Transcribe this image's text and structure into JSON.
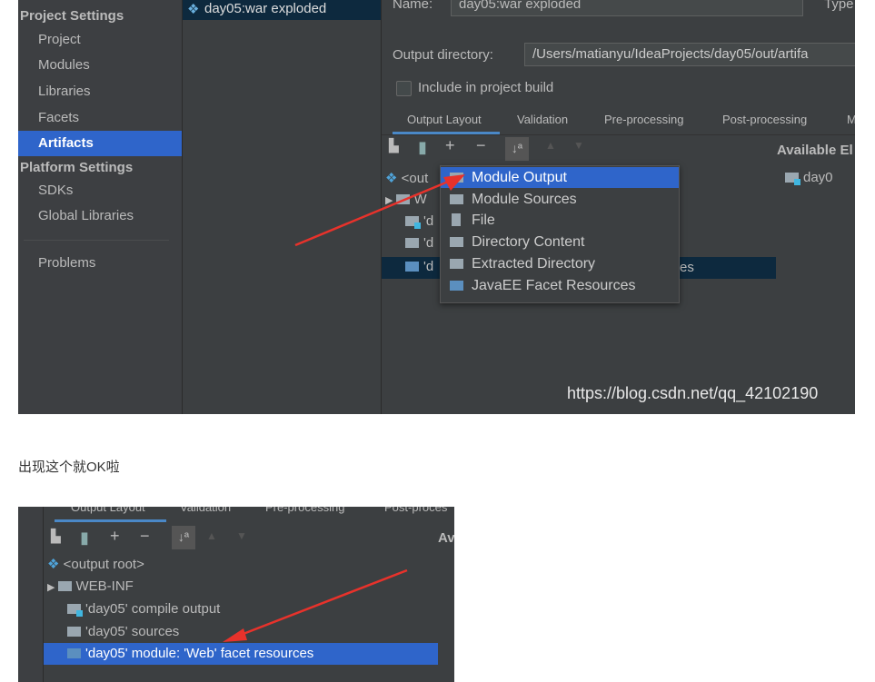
{
  "screenshot1": {
    "sidebar": {
      "project_settings": "Project Settings",
      "items": [
        "Project",
        "Modules",
        "Libraries",
        "Facets",
        "Artifacts"
      ],
      "platform_settings": "Platform Settings",
      "platform_items": [
        "SDKs",
        "Global Libraries"
      ],
      "problems": "Problems",
      "selected": "Artifacts"
    },
    "artifact": "day05:war exploded",
    "name_label": "Name:",
    "name_value": "day05:war exploded",
    "type_label": "Type",
    "output_dir_label": "Output directory:",
    "output_dir_value": "/Users/matianyu/IdeaProjects/day05/out/artifa",
    "include_label": "Include in project build",
    "tabs": [
      "Output Layout",
      "Validation",
      "Pre-processing",
      "Post-processing",
      "M"
    ],
    "available_label": "Available El",
    "available_item": "day0",
    "tree": [
      "<out",
      "W",
      "'d",
      "'d",
      "'d"
    ],
    "tree_tail": "es",
    "menu": [
      "Module Output",
      "Module Sources",
      "File",
      "Directory Content",
      "Extracted Directory",
      "JavaEE Facet Resources"
    ],
    "watermark": "https://blog.csdn.net/qq_42102190"
  },
  "caption": "出现这个就OK啦",
  "screenshot2": {
    "tabs": [
      "Output Layout",
      "Validation",
      "Pre-processing",
      "Post-proces"
    ],
    "available_label": "Av",
    "tree": [
      "<output root>",
      "WEB-INF",
      "'day05' compile output",
      "'day05' sources",
      "'day05' module: 'Web' facet resources"
    ]
  },
  "colors": {
    "selection": "#2f65ca",
    "arrow": "#e8322b",
    "panel": "#3c3f41"
  }
}
